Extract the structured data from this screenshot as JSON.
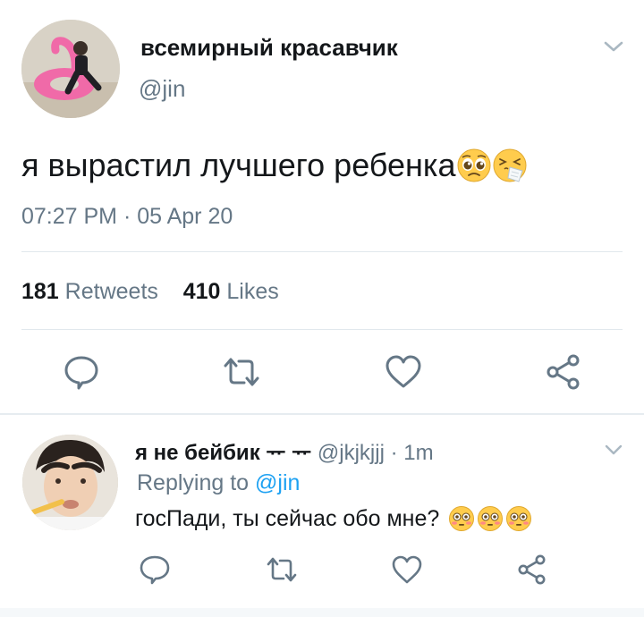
{
  "tweet": {
    "author_name": "всемирный красавчик",
    "author_handle": "@jin",
    "text": "я вырастил лучшего ребенка",
    "emojis": [
      "pleading-face",
      "sneezing-face"
    ],
    "timestamp": "07:27 PM · 05 Apr 20",
    "retweets_count": "181",
    "retweets_label": "Retweets",
    "likes_count": "410",
    "likes_label": "Likes",
    "actions": [
      "reply-icon",
      "retweet-icon",
      "like-icon",
      "share-icon"
    ]
  },
  "reply": {
    "author_name": "я не бейбик ᅲ ᅲ",
    "author_handle": "@jkjkjjj",
    "time": " · 1m",
    "replying_label": "Replying to",
    "replying_mention": "@jin",
    "text": "госПади, ты сейчас обо мне?",
    "emojis": [
      "flushed-face",
      "flushed-face",
      "flushed-face"
    ],
    "actions": [
      "reply-icon",
      "retweet-icon",
      "like-icon",
      "share-icon"
    ]
  },
  "colors": {
    "text": "#14171a",
    "secondary": "#657786",
    "link": "#1da1f2",
    "divider": "#e1e8ed",
    "emoji_yellow": "#ffcc4d"
  }
}
